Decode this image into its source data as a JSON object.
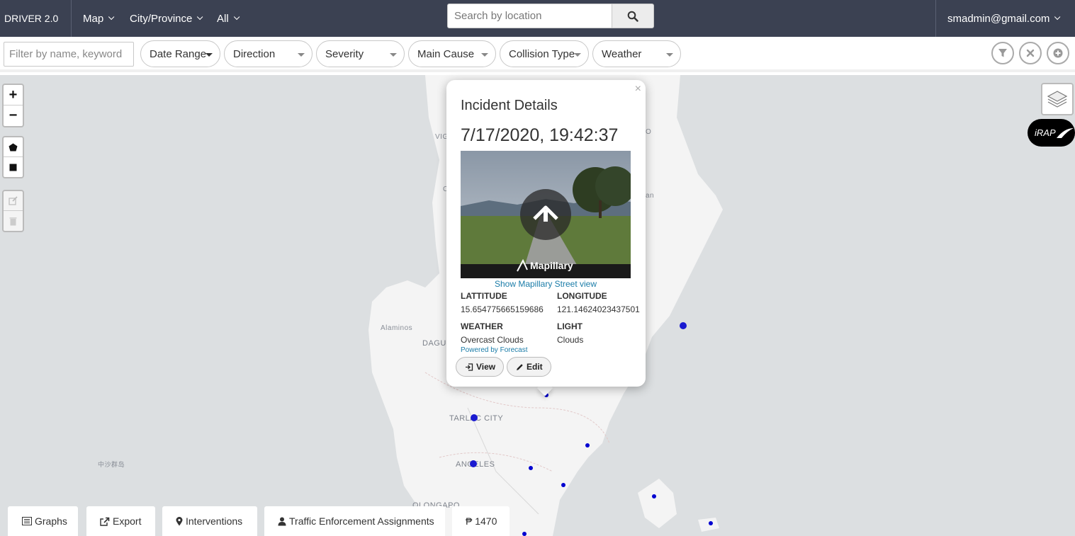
{
  "navbar": {
    "brand": "DRIVER 2.0",
    "menu_map": "Map",
    "menu_region": "City/Province",
    "menu_all": "All",
    "search_placeholder": "Search by location",
    "user_email": "smadmin@gmail.com"
  },
  "filters": {
    "keyword_placeholder": "Filter by name, keyword",
    "date_range": "Date Range",
    "direction": "Direction",
    "severity": "Severity",
    "main_cause": "Main Cause",
    "collision_type": "Collision Type",
    "weather": "Weather"
  },
  "map": {
    "places": [
      "Alaminos",
      "DAGU",
      "TARLAC CITY",
      "ANGELES",
      "OLONGAPO",
      "中沙群岛",
      "VIG",
      "O",
      "C",
      "an"
    ],
    "irap_label": "iRAP"
  },
  "popup": {
    "title": "Incident Details",
    "datetime": "7/17/2020, 19:42:37",
    "image_brand": "Mapillary",
    "street_view_link": "Show Mapillary Street view",
    "latitude_label": "LATTITUDE",
    "latitude_value": "15.654775665159686",
    "longitude_label": "LONGITUDE",
    "longitude_value": "121.14624023437501",
    "weather_label": "WEATHER",
    "weather_value": "Overcast Clouds",
    "light_label": "LIGHT",
    "light_value": "Clouds",
    "powered_by": "Powered by Forecast",
    "view_button": "View",
    "edit_button": "Edit"
  },
  "bottom_tabs": {
    "graphs": "Graphs",
    "export": "Export",
    "interventions": "Interventions",
    "enforcement": "Traffic Enforcement Assignments",
    "cost": "₱ 1470"
  },
  "colors": {
    "navbar_bg": "#3b4152",
    "marker": "#0000d0",
    "link": "#1a7ca8"
  }
}
